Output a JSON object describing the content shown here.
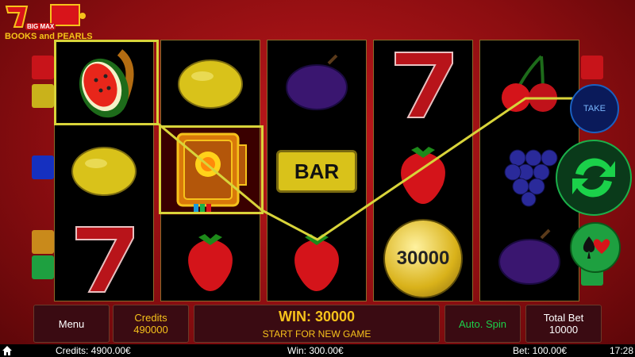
{
  "logo": {
    "line1": "BIG MAX",
    "line2": "BOOKS and PEARLS"
  },
  "reels": [
    [
      "watermelon-icon",
      "lemon-icon",
      "seven-icon"
    ],
    [
      "lemon-icon",
      "book-icon",
      "strawberry-icon"
    ],
    [
      "plum-icon",
      "bar-icon",
      "strawberry-icon"
    ],
    [
      "seven-icon",
      "strawberry-icon",
      "pearl-30000-icon"
    ],
    [
      "cherry-icon",
      "grapes-icon",
      "plum-icon"
    ]
  ],
  "bar_symbol_text": "BAR",
  "pearl_value": "30000",
  "buttons": {
    "take": "TAKE",
    "menu": "Menu",
    "auto_spin": "Auto. Spin"
  },
  "credits_box": {
    "label": "Credits",
    "value": "490000"
  },
  "win_box": {
    "title": "WIN: 30000",
    "subtitle": "START FOR NEW GAME"
  },
  "total_bet_box": {
    "label": "Total Bet",
    "value": "10000"
  },
  "status_bar": {
    "credits": "Credits: 4900.00€",
    "win": "Win: 300.00€",
    "bet": "Bet: 100.00€",
    "time": "17:28"
  },
  "colors": {
    "win_line": "#d8d43a",
    "accent_green": "#1bb04a",
    "gold": "#f6c21b"
  }
}
